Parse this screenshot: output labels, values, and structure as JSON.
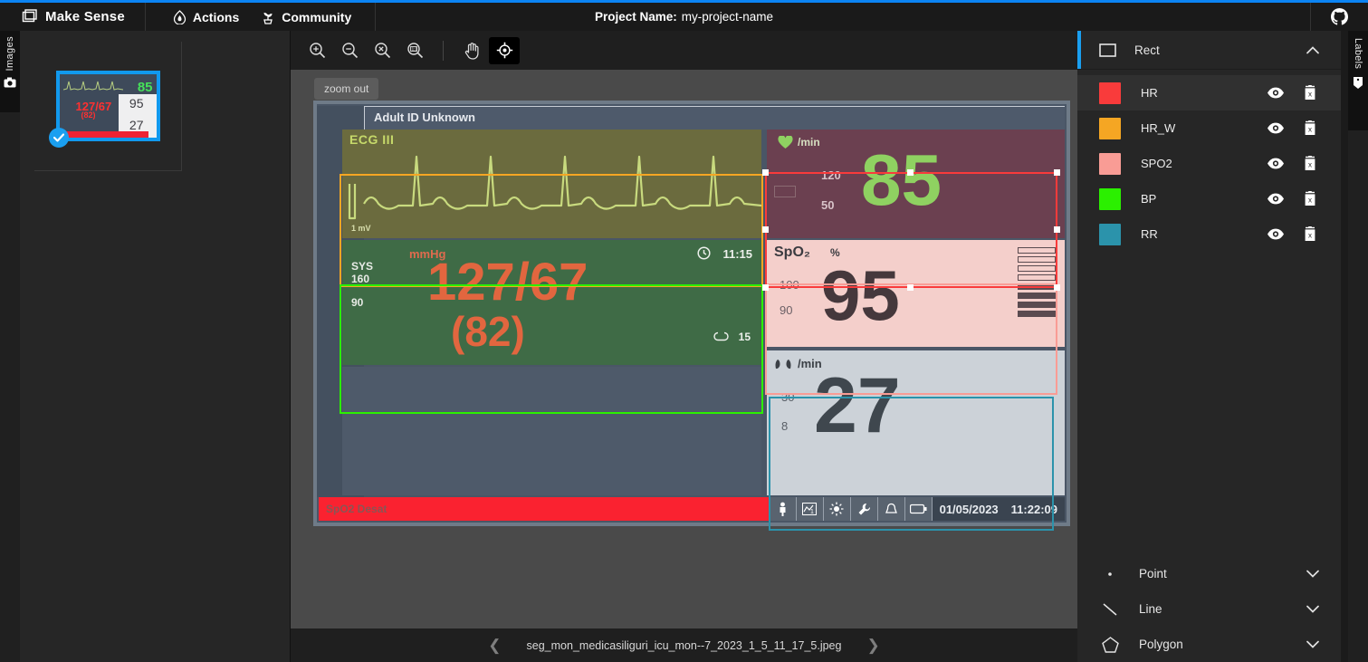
{
  "topbar": {
    "brand": "Make Sense",
    "brand_icon": "app-window-icon",
    "nav": [
      {
        "label": "Actions",
        "icon": "flame-icon"
      },
      {
        "label": "Community",
        "icon": "plant-icon"
      }
    ],
    "project_label": "Project Name:",
    "project_name": "my-project-name",
    "github_icon": "github-icon"
  },
  "left_tab": {
    "label": "Images",
    "icon": "camera-icon"
  },
  "thumbnail": {
    "hr": "85",
    "bp": "127/67",
    "bp_mean": "(82)",
    "spo2": "95",
    "rr": "27",
    "selected_icon": "check-icon"
  },
  "toolbar": {
    "buttons": [
      {
        "name": "zoom-in-icon",
        "label": "Zoom in",
        "active": false
      },
      {
        "name": "zoom-out-icon",
        "label": "Zoom out",
        "active": false
      },
      {
        "name": "zoom-fit-icon",
        "label": "Fit to screen",
        "active": false
      },
      {
        "name": "zoom-actual-icon",
        "label": "Actual size 1:1",
        "active": false
      },
      {
        "name": "pan-hand-icon",
        "label": "Pan",
        "active": false
      },
      {
        "name": "select-target-icon",
        "label": "Select / move",
        "active": true
      }
    ],
    "zoom_out_button": "zoom out"
  },
  "bottom_nav": {
    "prev_icon": "chevron-left-icon",
    "next_icon": "chevron-right-icon",
    "filename": "seg_mon_medicasiliguri_icu_mon--7_2023_1_5_11_17_5.jpeg"
  },
  "monitor": {
    "patient_header": "Adult   ID Unknown",
    "ecg": {
      "lead": "ECG III",
      "scale": "1 mV"
    },
    "hr": {
      "icon": "heart-icon",
      "unit": "/min",
      "limit_high": "120",
      "limit_low": "50",
      "value": "85"
    },
    "bp": {
      "unit": "mmHg",
      "label": "SYS",
      "limit_high": "160",
      "limit_low": "90",
      "value": "127/67",
      "mean": "(82)",
      "clock_icon": "clock-icon",
      "clock_time": "11:15",
      "cycle_icon": "cuff-cycle-icon",
      "cycle_value": "15"
    },
    "spo2": {
      "label": "SpO₂",
      "unit": "%",
      "limit_high": "100",
      "limit_low": "90",
      "value": "95"
    },
    "rr": {
      "icon": "lungs-icon",
      "unit": "/min",
      "limit_high": "30",
      "limit_low": "8",
      "value": "27"
    },
    "status": {
      "alarm": "SpO2 Desat",
      "icons": [
        "patient-icon",
        "trend-icon",
        "brightness-icon",
        "wrench-icon",
        "bell-icon",
        "battery-icon"
      ],
      "date": "01/05/2023",
      "time": "11:22:09"
    }
  },
  "annotations": [
    {
      "label": "HR_W",
      "color": "#f5a623"
    },
    {
      "label": "HR",
      "color": "#f93b3b",
      "selected": true
    },
    {
      "label": "BP",
      "color": "#2bf000"
    },
    {
      "label": "SPO2",
      "color": "#f99c95"
    },
    {
      "label": "RR",
      "color": "#2b93ab"
    }
  ],
  "right_panel": {
    "section": {
      "icon": "rect-icon",
      "title": "Rect",
      "chevron": "chevron-up-icon"
    },
    "labels": [
      {
        "name": "HR",
        "color": "#f93b3b",
        "eye_icon": "eye-icon",
        "delete_icon": "trash-icon",
        "active": true
      },
      {
        "name": "HR_W",
        "color": "#f5a623",
        "eye_icon": "eye-icon",
        "delete_icon": "trash-icon",
        "active": false
      },
      {
        "name": "SPO2",
        "color": "#f99c95",
        "eye_icon": "eye-icon",
        "delete_icon": "trash-icon",
        "active": false
      },
      {
        "name": "BP",
        "color": "#2bf000",
        "eye_icon": "eye-icon",
        "delete_icon": "trash-icon",
        "active": false
      },
      {
        "name": "RR",
        "color": "#2b93ab",
        "eye_icon": "eye-icon",
        "delete_icon": "trash-icon",
        "active": false
      }
    ],
    "footer_sections": [
      {
        "title": "Point",
        "icon": "point-icon",
        "chevron": "chevron-down-icon"
      },
      {
        "title": "Line",
        "icon": "line-icon",
        "chevron": "chevron-down-icon"
      },
      {
        "title": "Polygon",
        "icon": "polygon-icon",
        "chevron": "chevron-down-icon"
      }
    ]
  },
  "right_tab": {
    "label": "Labels",
    "icon": "tag-icon"
  }
}
